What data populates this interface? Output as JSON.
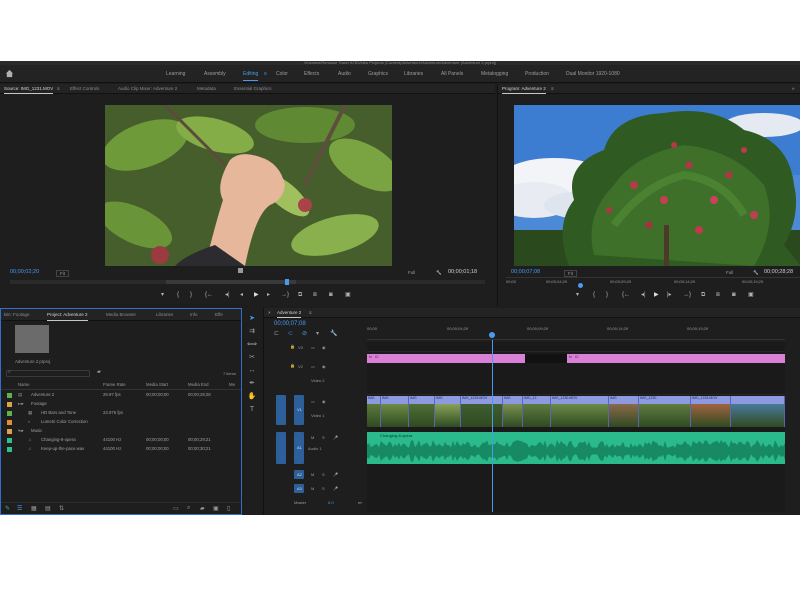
{
  "title_path": "/Volumes/Renouse Tower 878/Video Projects (Content)/Adventure/Adventure/Adventure (Adventure 2.prproj)",
  "workspaces": {
    "items": [
      "Learning",
      "Assembly",
      "Editing",
      "Color",
      "Effects",
      "Audio",
      "Graphics",
      "Libraries",
      "All Panels",
      "Metalogging",
      "Production",
      "Dual Monitor 1920-1080"
    ],
    "active": "Editing",
    "menu_glyph": "≡"
  },
  "source_panel": {
    "tabs": [
      "Source: IMG_1231.MOV",
      "Effect Controls",
      "Audio Clip Mixer: Adventure 2",
      "Metadata",
      "Essential Graphics"
    ],
    "menu_glyph": "≡",
    "timecode": "00;00;02;20",
    "fit": "Fit",
    "quality": "Full",
    "duration": "00;00;01;18"
  },
  "program_panel": {
    "title": "Program: Adventure 2",
    "menu_glyph": "≡",
    "expand_glyph": "»",
    "timecode": "00;00;07;08",
    "fit": "Fit",
    "quality": "Full",
    "duration": "00;00;28;28",
    "ruler": [
      "00;00",
      "00;00;04;29",
      "00;00;09;29",
      "00;00;14;29",
      "00;00;19;29"
    ]
  },
  "project_panel": {
    "tabs": [
      "Bin: Footage",
      "Project: Adventure 2",
      "Media Browser",
      "Libraries",
      "Info",
      "Effe"
    ],
    "project_file": "Adventure 2.prproj",
    "item_count": "7 items",
    "columns": [
      "Name",
      "Frame Rate",
      "Media Start",
      "Media End",
      "Me"
    ],
    "rows": [
      {
        "name": "Adventure 2",
        "rate": "29.97 fps",
        "start": "00;00;00;00",
        "end": "00;00;28;28",
        "color": "#5fb24b"
      },
      {
        "name": "Footage",
        "rate": "",
        "start": "",
        "end": "",
        "color": "#dda34a"
      },
      {
        "name": "HD Bars and Tone",
        "rate": "23.976 fps",
        "start": "",
        "end": "",
        "color": "#5fb24b"
      },
      {
        "name": "Lumetri Color Correction",
        "rate": "",
        "start": "",
        "end": "",
        "color": "#e0902e"
      },
      {
        "name": "Music",
        "rate": "",
        "start": "",
        "end": "",
        "color": "#dda34a"
      },
      {
        "name": "Changing-8-opera",
        "rate": "44100 Hz",
        "start": "00;00;00;00",
        "end": "00;00;29;21",
        "color": "#2ec08a"
      },
      {
        "name": "Keep-up-the-pace.wav",
        "rate": "44100 Hz",
        "start": "00;00;00;00",
        "end": "00;00;30;21",
        "color": "#2ec08a"
      }
    ]
  },
  "timeline": {
    "tab": "Adventure 2",
    "timecode": "00;00;07;08",
    "ruler": [
      "00;00",
      "00;00;04;29",
      "00;00;09;29",
      "00;00;14;29",
      "00;00;19;29"
    ],
    "tracks": {
      "v3": "V3",
      "v2": "V2",
      "v1": "V1",
      "a1": "A1",
      "a2": "A2",
      "a3": "A3"
    },
    "names": {
      "video2": "Video 2",
      "video1": "Video 1",
      "audio1": "Audio 1",
      "master": "Master"
    },
    "master_level": "0.0",
    "clip_fx": "fx",
    "clip_ic": "IC",
    "video_clips": [
      "IMG",
      "IMG",
      "IMG",
      "IMG",
      "IMG_1219.MOV",
      "IMG",
      "IMG_12",
      "IMG_1230.MOV",
      "IMG",
      "IMG_1220",
      "IMG_1233.MOV"
    ],
    "audio_clip": "Changing-8-opera"
  },
  "colors": {
    "accent": "#4a9bf0",
    "pink_clip": "#d981d6",
    "audio_clip": "#2aba8b",
    "video_clip": "#8d9ae0"
  }
}
